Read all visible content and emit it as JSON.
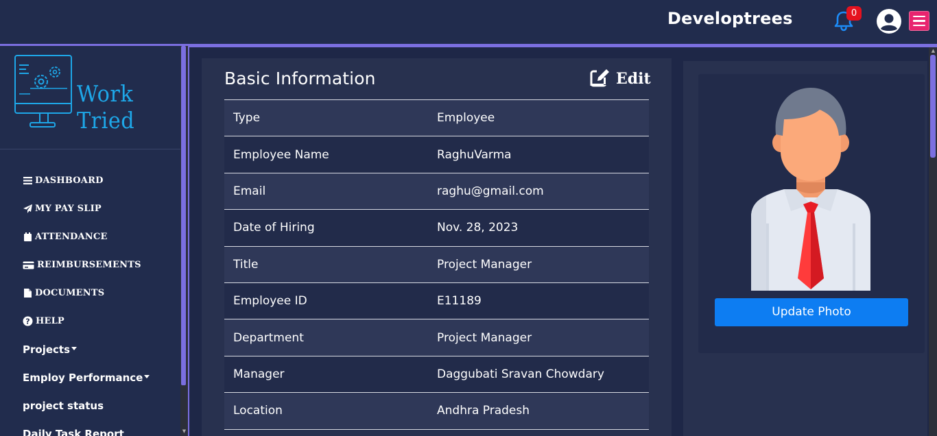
{
  "header": {
    "brand": "Developtrees",
    "notification_count": "0"
  },
  "sidebar": {
    "logo_text": "Work Tried",
    "items": [
      {
        "label": "DASHBOARD",
        "icon": "bars-icon"
      },
      {
        "label": "MY PAY SLIP",
        "icon": "paper-plane-icon"
      },
      {
        "label": "ATTENDANCE",
        "icon": "calendar-icon"
      },
      {
        "label": "REIMBURSEMENTS",
        "icon": "credit-card-icon"
      },
      {
        "label": "DOCUMENTS",
        "icon": "file-icon"
      },
      {
        "label": "HELP",
        "icon": "question-circle-icon"
      },
      {
        "label": "Projects"
      },
      {
        "label": "Employ Performance"
      },
      {
        "label": "project status"
      },
      {
        "label": "Daily Task Report"
      }
    ]
  },
  "info": {
    "title": "Basic Information",
    "edit_label": "Edit",
    "rows": [
      {
        "key": "Type",
        "value": "Employee"
      },
      {
        "key": "Employee Name",
        "value": "RaghuVarma"
      },
      {
        "key": "Email",
        "value": "raghu@gmail.com"
      },
      {
        "key": "Date of Hiring",
        "value": "Nov. 28, 2023"
      },
      {
        "key": "Title",
        "value": "Project Manager"
      },
      {
        "key": "Employee ID",
        "value": "E11189"
      },
      {
        "key": "Department",
        "value": "Project Manager"
      },
      {
        "key": "Manager",
        "value": "Daggubati Sravan Chowdary"
      },
      {
        "key": "Location",
        "value": "Andhra Pradesh"
      }
    ]
  },
  "photo": {
    "update_label": "Update Photo"
  },
  "colors": {
    "accent": "#7b6fe0",
    "primary_button": "#0d7df2",
    "menu_button": "#e8246f",
    "badge": "#e5121f",
    "logo": "#1ea7e8"
  }
}
